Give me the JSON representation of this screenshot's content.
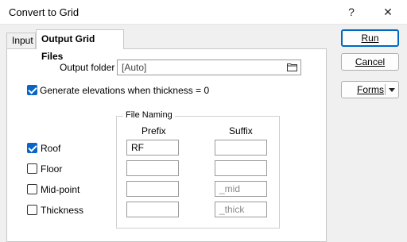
{
  "window": {
    "title": "Convert to Grid",
    "help": "?",
    "close": "✕"
  },
  "tabs": [
    {
      "label": "Input"
    },
    {
      "label": "Output Grid Files"
    }
  ],
  "output": {
    "folder_label": "Output folder",
    "folder_value": "[Auto]",
    "generate_label": "Generate elevations when thickness = 0",
    "generate_checked": true
  },
  "file_naming": {
    "legend": "File Naming",
    "prefix_header": "Prefix",
    "suffix_header": "Suffix",
    "rows": [
      {
        "label": "Roof",
        "checked": true,
        "prefix": "RF",
        "suffix": ""
      },
      {
        "label": "Floor",
        "checked": false,
        "prefix": "",
        "suffix": ""
      },
      {
        "label": "Mid-point",
        "checked": false,
        "prefix": "",
        "suffix_placeholder": "_mid"
      },
      {
        "label": "Thickness",
        "checked": false,
        "prefix": "",
        "suffix_placeholder": "_thick"
      }
    ]
  },
  "buttons": {
    "run": "Run",
    "cancel": "Cancel",
    "forms": "Forms"
  }
}
